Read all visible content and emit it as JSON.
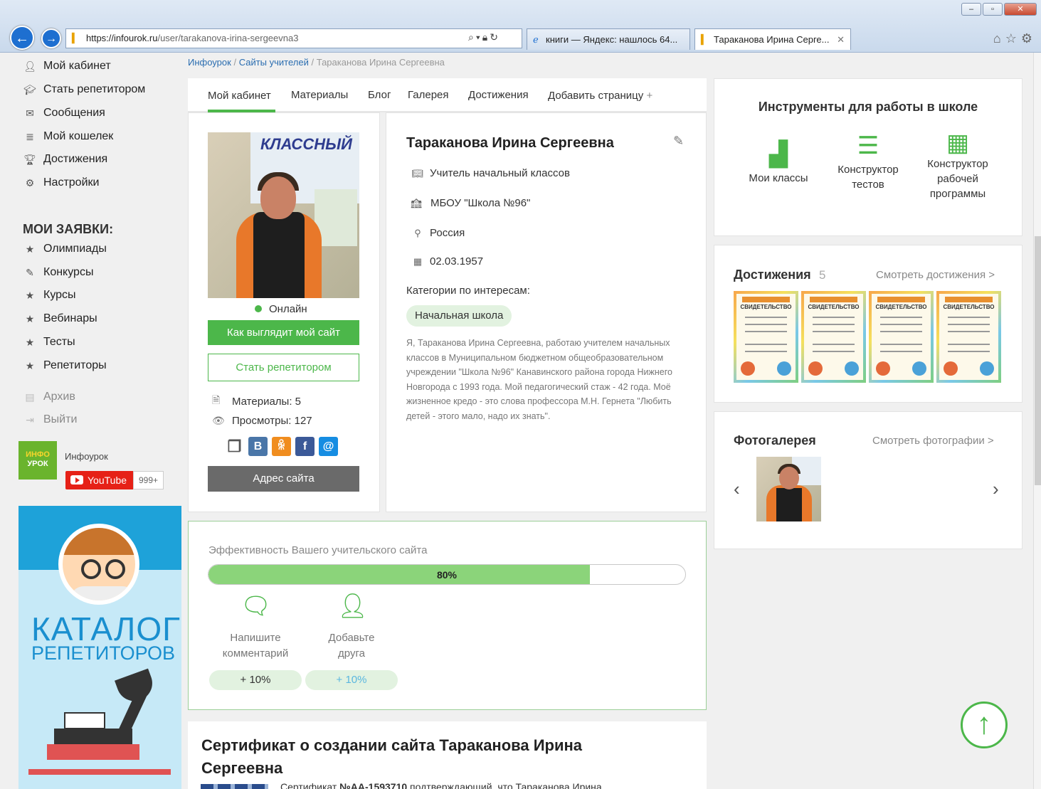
{
  "browser": {
    "url_prefix": "https://infourok.ru",
    "url_path": "/user/tarakanova-irina-sergeevna3",
    "tabs": [
      {
        "label": "книги — Яндекс: нашлось 64..."
      },
      {
        "label": "Тараканова Ирина Серге...",
        "active": true
      }
    ],
    "window_controls": [
      "–",
      "▫",
      "✕"
    ],
    "icons": [
      "home-icon",
      "star-icon",
      "gear-icon"
    ]
  },
  "sidebar": {
    "items": [
      {
        "label": "Мой кабинет",
        "icon": "user-icon"
      },
      {
        "label": "Стать репетитором",
        "icon": "graduation-cap-icon"
      },
      {
        "label": "Сообщения",
        "icon": "envelope-icon"
      },
      {
        "label": "Мой кошелек",
        "icon": "coins-icon"
      },
      {
        "label": "Достижения",
        "icon": "trophy-icon"
      },
      {
        "label": "Настройки",
        "icon": "gear-icon"
      }
    ],
    "requests_title": "МОИ ЗАЯВКИ:",
    "requests": [
      {
        "label": "Олимпиады",
        "icon": "star-icon"
      },
      {
        "label": "Конкурсы",
        "icon": "edit-icon"
      },
      {
        "label": "Курсы",
        "icon": "star-icon"
      },
      {
        "label": "Вебинары",
        "icon": "star-icon"
      },
      {
        "label": "Тесты",
        "icon": "star-icon"
      },
      {
        "label": "Репетиторы",
        "icon": "star-icon"
      }
    ],
    "muted": [
      {
        "label": "Архив",
        "icon": "archive-icon"
      },
      {
        "label": "Выйти",
        "icon": "logout-icon"
      }
    ],
    "logo_line1": "ИНФО",
    "logo_line2": "УРОК",
    "channel_name": "Инфоурок",
    "youtube_label": "YouTube",
    "youtube_count": "999+",
    "catalog_line1": "КАТАЛОГ",
    "catalog_line2": "РЕПЕТИТОРОВ"
  },
  "breadcrumbs": {
    "items": [
      "Инфоурок",
      "Сайты учителей"
    ],
    "current": "Тараканова Ирина Сергеевна",
    "separator": "/"
  },
  "profile_tabs": [
    "Мой кабинет",
    "Материалы",
    "Блог",
    "Галерея",
    "Достижения",
    "Добавить страницу"
  ],
  "profile_tab_plus": "+",
  "profile": {
    "status": "Онлайн",
    "btn_look": "Как выглядит мой сайт",
    "btn_tutor": "Стать репетитором",
    "materials": "Материалы: 5",
    "views": "Просмотры: 127",
    "socials": [
      {
        "icon": "share-icon",
        "glyph": "❐",
        "color": "#555555"
      },
      {
        "icon": "vk-icon",
        "glyph": "В",
        "color": "#4a76a8"
      },
      {
        "icon": "ok-icon",
        "glyph": "ꆜ",
        "color": "#f08d1f"
      },
      {
        "icon": "facebook-icon",
        "glyph": "f",
        "color": "#3b5998"
      },
      {
        "icon": "mail-icon",
        "glyph": "@",
        "color": "#168de2"
      }
    ],
    "btn_address": "Адрес сайта",
    "name": "Тараканова Ирина Сергеевна",
    "position": "Учитель начальный классов",
    "school": "МБОУ \"Школа №96\"",
    "country": "Россия",
    "birthdate": "02.03.1957",
    "categories_title": "Категории по интересам:",
    "category": "Начальная школа",
    "bio": "Я, Тараканова Ирина Сергеевна, работаю учителем начальных классов в Муниципальном бюджетном общеобразовательном учреждении \"Школа №96\" Канавинского района города Нижнего Новгорода с 1993 года. Мой педагогический стаж - 42 года. Моё жизненное кредо - это слова профессора М.Н. Гернета \"Любить детей - этого мало, надо их знать\"."
  },
  "effectiveness": {
    "title": "Эффективность Вашего учительского сайта",
    "percent_label": "80%",
    "percent_value": 0.8,
    "tasks": [
      {
        "label_line1": "Напишите",
        "label_line2": "комментарий",
        "bonus": "+ 10%",
        "icon": "comment-icon",
        "bonus_color": "#333333"
      },
      {
        "label_line1": "Добавьте",
        "label_line2": "друга",
        "bonus": "+ 10%",
        "icon": "add-user-icon",
        "bonus_color": "#5bb7df"
      }
    ]
  },
  "certificate": {
    "title": "Сертификат о создании сайта Тараканова Ирина Сергеевна",
    "text_prefix": "Сертификат ",
    "text_number": "№АА-1593710",
    "text_suffix": " подтверждающий, что Тараканова Ирина"
  },
  "tools": {
    "title": "Инструменты для работы в школе",
    "items": [
      {
        "label_line1": "Мои классы",
        "label_line2": "",
        "label_line3": "",
        "icon": "classes-icon"
      },
      {
        "label_line1": "Конструктор",
        "label_line2": "тестов",
        "label_line3": "",
        "icon": "list-icon"
      },
      {
        "label_line1": "Конструктор",
        "label_line2": "рабочей",
        "label_line3": "программы",
        "icon": "calendar-add-icon"
      }
    ]
  },
  "achievements": {
    "title": "Достижения",
    "count": "5",
    "link": "Смотреть достижения >",
    "cert_label": "СВИДЕТЕЛЬСТВО"
  },
  "gallery": {
    "title": "Фотогалерея",
    "link": "Смотреть фотографии >",
    "prev": "‹",
    "next": "›"
  },
  "photo_headline": "КЛАССНЫЙ",
  "colors": {
    "accent": "#4cb74a",
    "link": "#2a6db0",
    "address_button": "#6a6a6a"
  }
}
